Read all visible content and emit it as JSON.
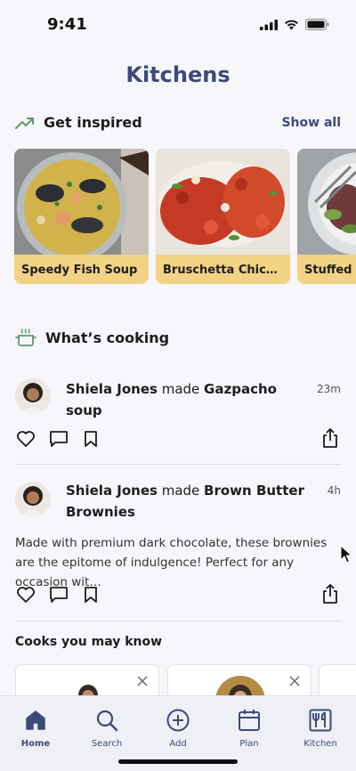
{
  "status_bar": {
    "time": "9:41"
  },
  "page_title": "Kitchens",
  "inspired": {
    "title": "Get inspired",
    "show_all": "Show all",
    "cards": [
      {
        "label": "Speedy Fish Soup"
      },
      {
        "label": "Bruschetta Chick…"
      },
      {
        "label": "Stuffed P"
      }
    ]
  },
  "cooking": {
    "title": "What’s cooking",
    "posts": [
      {
        "author": "Shiela Jones",
        "verb": " made ",
        "dish": "Gazpacho soup",
        "time": "23m"
      },
      {
        "author": "Shiela Jones",
        "verb": " made ",
        "dish": "Brown Butter Brownies",
        "time": "4h",
        "body": "Made with premium dark chocolate, these brownies are the epitome of indulgence! Perfect for any occasion wit…"
      }
    ]
  },
  "cooks": {
    "title": "Cooks you may know"
  },
  "tabs": [
    {
      "label": "Home",
      "icon": "home-icon",
      "active": true
    },
    {
      "label": "Search",
      "icon": "search-icon"
    },
    {
      "label": "Add",
      "icon": "add-icon"
    },
    {
      "label": "Plan",
      "icon": "calendar-icon"
    },
    {
      "label": "Kitchen",
      "icon": "kitchen-icon"
    }
  ],
  "colors": {
    "brand": "#3c4a7a",
    "caption_bg": "#f2d283",
    "accent_green": "#5a9a6a"
  }
}
